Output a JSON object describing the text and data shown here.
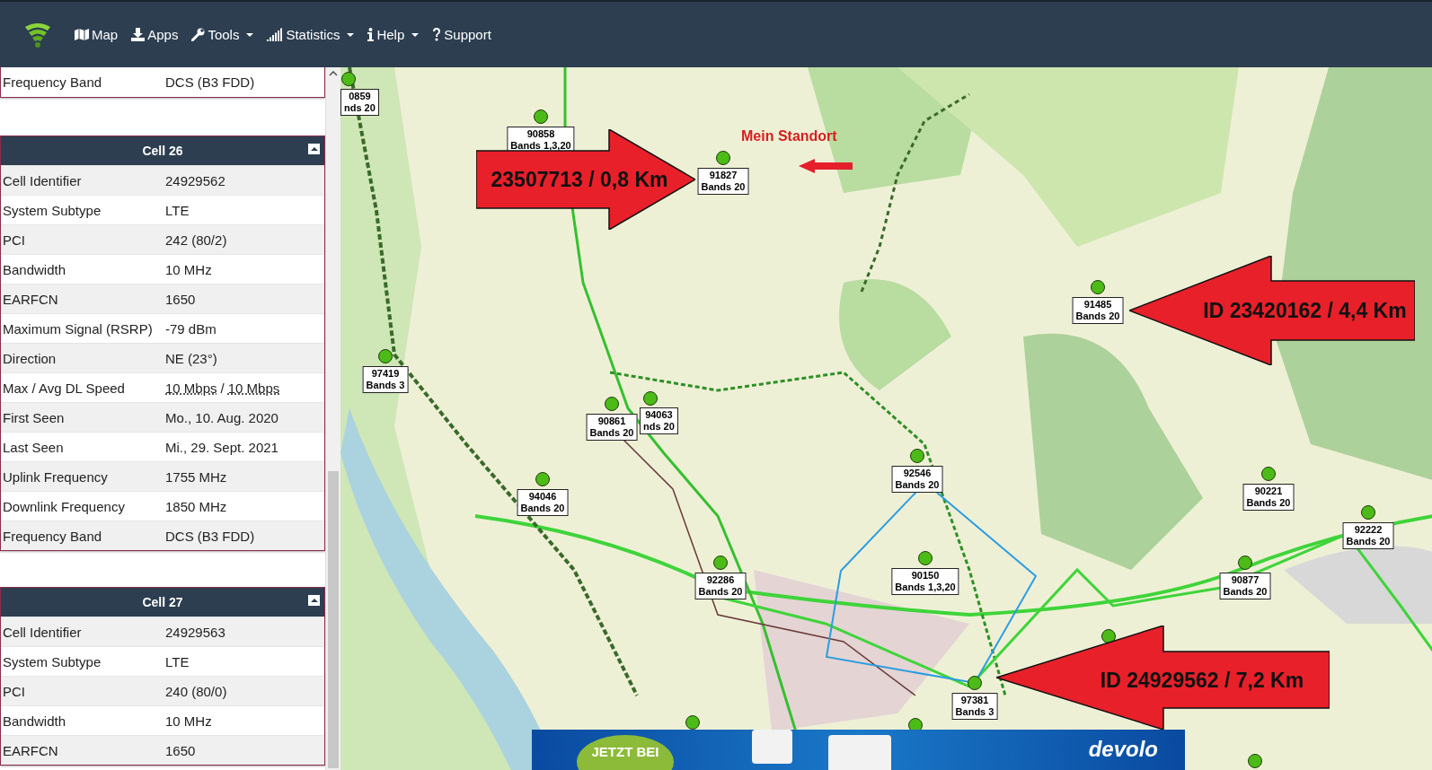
{
  "nav": {
    "items": [
      {
        "label": "Map",
        "dropdown": false
      },
      {
        "label": "Apps",
        "dropdown": false
      },
      {
        "label": "Tools",
        "dropdown": true
      },
      {
        "label": "Statistics",
        "dropdown": true
      },
      {
        "label": "Help",
        "dropdown": true
      },
      {
        "label": "Support",
        "dropdown": false
      }
    ]
  },
  "cell_panels": [
    {
      "kind": "tail",
      "rows": [
        {
          "label": "Frequency Band",
          "value": "DCS (B3 FDD)"
        }
      ]
    },
    {
      "kind": "card",
      "title": "Cell 26",
      "rows": [
        {
          "label": "Cell Identifier",
          "value": "24929562"
        },
        {
          "label": "System Subtype",
          "value": "LTE"
        },
        {
          "label": "PCI",
          "value": "242 (80/2)"
        },
        {
          "label": "Bandwidth",
          "value": "10 MHz"
        },
        {
          "label": "EARFCN",
          "value": "1650"
        },
        {
          "label": "Maximum Signal (RSRP)",
          "value": "-79 dBm"
        },
        {
          "label": "Direction",
          "value": "NE (23°)"
        },
        {
          "label": "Max / Avg DL Speed",
          "values": [
            "10 Mbps",
            "10 Mbps"
          ],
          "separator": "/"
        },
        {
          "label": "First Seen",
          "value": "Mo., 10. Aug. 2020"
        },
        {
          "label": "Last Seen",
          "value": "Mi., 29. Sept. 2021"
        },
        {
          "label": "Uplink Frequency",
          "value": "1755 MHz"
        },
        {
          "label": "Downlink Frequency",
          "value": "1850 MHz"
        },
        {
          "label": "Frequency Band",
          "value": "DCS (B3 FDD)"
        }
      ]
    },
    {
      "kind": "card",
      "title": "Cell 27",
      "rows": [
        {
          "label": "Cell Identifier",
          "value": "24929563"
        },
        {
          "label": "System Subtype",
          "value": "LTE"
        },
        {
          "label": "PCI",
          "value": "240 (80/0)"
        },
        {
          "label": "Bandwidth",
          "value": "10 MHz"
        },
        {
          "label": "EARFCN",
          "value": "1650"
        }
      ]
    }
  ],
  "map": {
    "markers": [
      {
        "id": "0859",
        "bands": "nds 20"
      },
      {
        "id": "90858",
        "bands": "Bands 1,3,20"
      },
      {
        "id": "91827",
        "bands": "Bands 20"
      },
      {
        "id": "91485",
        "bands": "Bands 20"
      },
      {
        "id": "97419",
        "bands": "Bands 3"
      },
      {
        "id": "90861",
        "bands": "Bands 20"
      },
      {
        "id": "94063",
        "bands": "nds 20"
      },
      {
        "id": "94046",
        "bands": "Bands 20"
      },
      {
        "id": "92546",
        "bands": "Bands 20"
      },
      {
        "id": "90221",
        "bands": "Bands 20"
      },
      {
        "id": "92222",
        "bands": "Bands 20"
      },
      {
        "id": "92286",
        "bands": "Bands 20"
      },
      {
        "id": "90150",
        "bands": "Bands 1,3,20"
      },
      {
        "id": "90877",
        "bands": "Bands 20"
      },
      {
        "id": "97381",
        "bands": "Bands 3"
      }
    ],
    "location_label": "Mein Standort",
    "annotations": [
      {
        "text": "23507713 / 0,8 Km"
      },
      {
        "text": "ID 23420162 / 4,4 Km"
      },
      {
        "text": "ID 24929562 / 7,2 Km"
      }
    ]
  },
  "ad": {
    "badge": "JETZT BEI",
    "brand": "devolo"
  }
}
